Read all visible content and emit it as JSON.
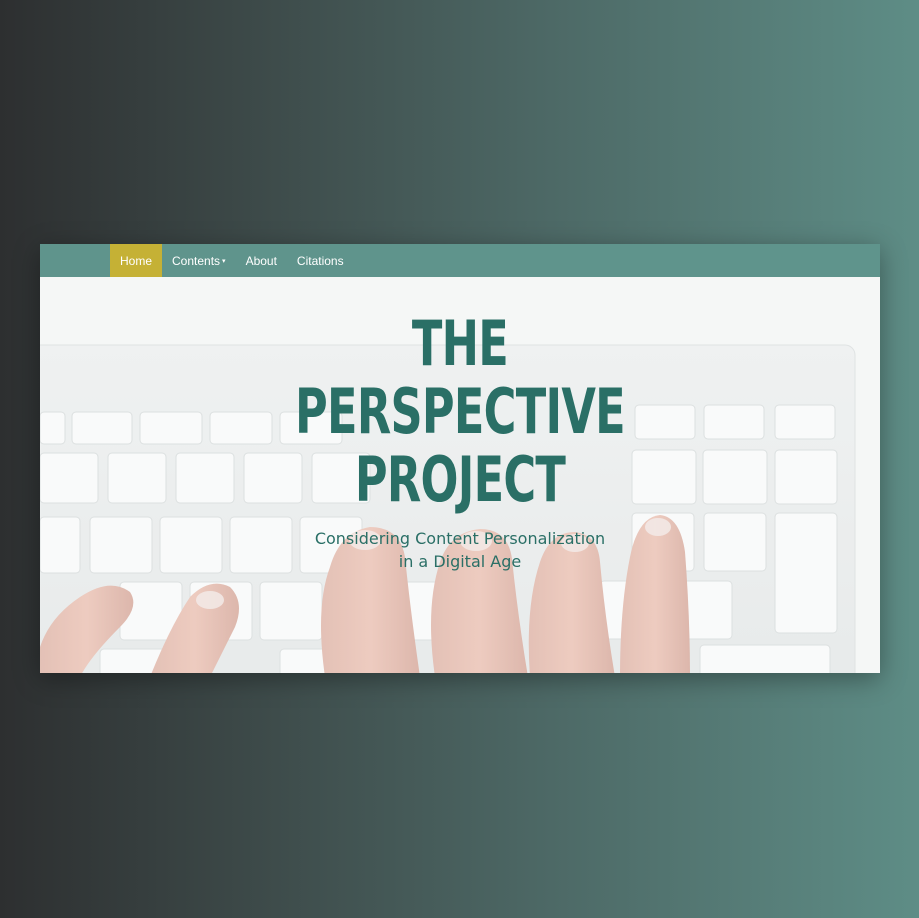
{
  "nav": {
    "items": [
      {
        "label": "Home",
        "active": true
      },
      {
        "label": "Contents",
        "dropdown": true
      },
      {
        "label": "About"
      },
      {
        "label": "Citations"
      }
    ],
    "caret": "▾"
  },
  "hero": {
    "title_lines": [
      "THE",
      "PERSPECTIVE",
      "PROJECT"
    ],
    "subtitle_lines": [
      "Considering Content Personalization",
      "in a Digital Age"
    ],
    "image": "keyboard-with-hands"
  },
  "colors": {
    "nav_bg": "#5f948c",
    "nav_active": "#c5b135",
    "title": "#2a6f66"
  }
}
